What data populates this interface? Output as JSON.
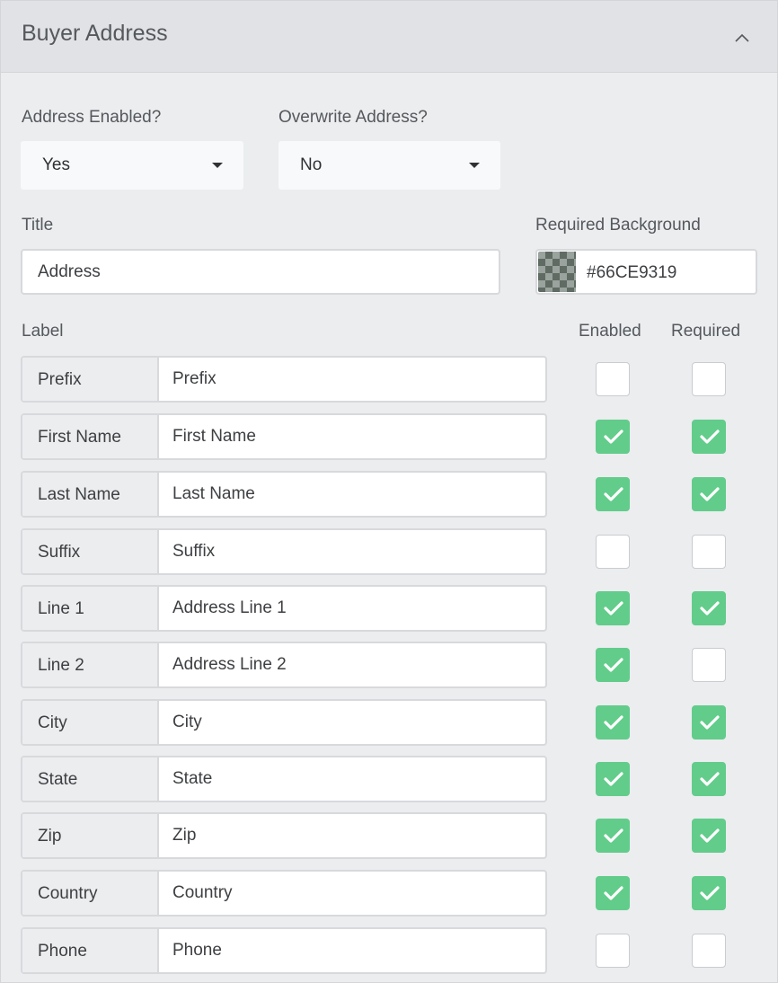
{
  "header": {
    "title": "Buyer Address"
  },
  "address_enabled": {
    "label": "Address Enabled?",
    "value": "Yes"
  },
  "overwrite_address": {
    "label": "Overwrite Address?",
    "value": "No"
  },
  "title_field": {
    "label": "Title",
    "value": "Address"
  },
  "required_background": {
    "label": "Required Background",
    "value": "#66CE9319"
  },
  "columns": {
    "label": "Label",
    "enabled": "Enabled",
    "required": "Required"
  },
  "colors": {
    "checked": "#62cc8b",
    "panel_bg": "#ebedef",
    "header_bg": "#e0e2e5"
  },
  "fields": [
    {
      "name": "Prefix",
      "value": "Prefix",
      "enabled": false,
      "required": false
    },
    {
      "name": "First Name",
      "value": "First Name",
      "enabled": true,
      "required": true
    },
    {
      "name": "Last Name",
      "value": "Last Name",
      "enabled": true,
      "required": true
    },
    {
      "name": "Suffix",
      "value": "Suffix",
      "enabled": false,
      "required": false
    },
    {
      "name": "Line 1",
      "value": "Address Line 1",
      "enabled": true,
      "required": true
    },
    {
      "name": "Line 2",
      "value": "Address Line 2",
      "enabled": true,
      "required": false
    },
    {
      "name": "City",
      "value": "City",
      "enabled": true,
      "required": true
    },
    {
      "name": "State",
      "value": "State",
      "enabled": true,
      "required": true
    },
    {
      "name": "Zip",
      "value": "Zip",
      "enabled": true,
      "required": true
    },
    {
      "name": "Country",
      "value": "Country",
      "enabled": true,
      "required": true
    },
    {
      "name": "Phone",
      "value": "Phone",
      "enabled": false,
      "required": false
    }
  ]
}
